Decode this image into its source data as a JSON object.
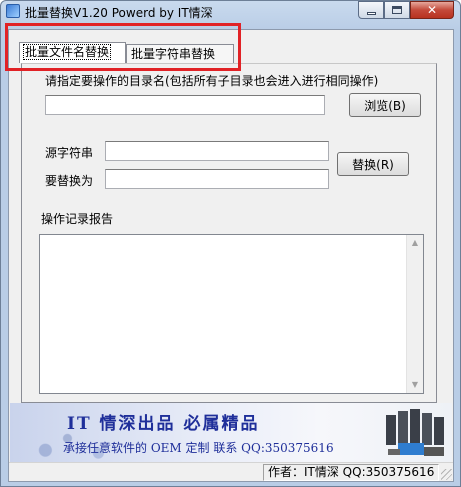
{
  "window": {
    "title": "批量替换V1.20  Powerd by IT情深"
  },
  "tabs": [
    {
      "label": "批量文件名替换",
      "selected": true
    },
    {
      "label": "批量字符串替换",
      "selected": false
    }
  ],
  "form": {
    "dir_label": "请指定要操作的目录名(包括所有子目录也会进入进行相同操作)",
    "dir_value": "",
    "browse_label": "浏览(B)",
    "source_label": "源字符串",
    "source_value": "",
    "replace_with_label": "要替换为",
    "replace_with_value": "",
    "replace_label": "替换(R)",
    "log_label": "操作记录报告",
    "log_value": ""
  },
  "banner": {
    "title": "IT 情深出品  必属精品",
    "subtitle": "承接任意软件的 OEM 定制  联系 QQ:350375616"
  },
  "statusbar": {
    "text": "作者：IT情深 QQ:350375616"
  },
  "colors": {
    "highlight": "#e12226",
    "banner_text": "#1f2f9a",
    "close_button": "#c4493a"
  },
  "icons": [
    "app-icon",
    "minimize-icon",
    "maximize-icon",
    "close-icon",
    "scroll-up-icon",
    "scroll-down-icon",
    "computer-cluster-icon",
    "size-grip-icon"
  ]
}
